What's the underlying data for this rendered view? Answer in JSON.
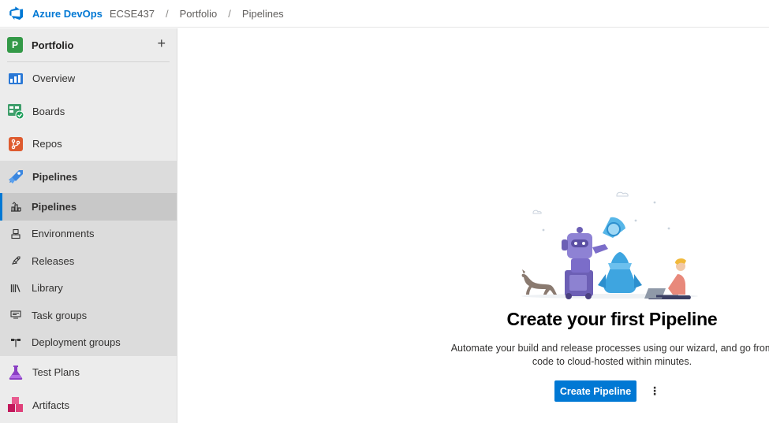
{
  "topbar": {
    "brand": "Azure DevOps",
    "breadcrumbs": [
      "ECSE437",
      "Portfolio",
      "Pipelines"
    ],
    "separator": "/"
  },
  "sidebar": {
    "project": {
      "initial": "P",
      "name": "Portfolio",
      "add_label": "+"
    },
    "items": [
      {
        "label": "Overview",
        "icon": "overview-icon"
      },
      {
        "label": "Boards",
        "icon": "boards-icon"
      },
      {
        "label": "Repos",
        "icon": "repos-icon"
      },
      {
        "label": "Pipelines",
        "icon": "pipelines-icon"
      },
      {
        "label": "Test Plans",
        "icon": "test-plans-icon"
      },
      {
        "label": "Artifacts",
        "icon": "artifacts-icon"
      }
    ],
    "pipelines_sub": [
      {
        "label": "Pipelines",
        "icon": "pipelines-sub-icon"
      },
      {
        "label": "Environments",
        "icon": "environments-icon"
      },
      {
        "label": "Releases",
        "icon": "releases-icon"
      },
      {
        "label": "Library",
        "icon": "library-icon"
      },
      {
        "label": "Task groups",
        "icon": "task-groups-icon"
      },
      {
        "label": "Deployment groups",
        "icon": "deployment-groups-icon"
      }
    ]
  },
  "main": {
    "title": "Create your first Pipeline",
    "description": "Automate your build and release processes using our wizard, and go from code to cloud-hosted within minutes.",
    "cta_label": "Create Pipeline",
    "more_label": "⋮"
  },
  "colors": {
    "accent": "#0078d4",
    "sidebar_bg": "#ececec",
    "group_bg": "#dcdcdc",
    "selected_bg": "#c8c8c8",
    "project_badge": "#339947"
  }
}
